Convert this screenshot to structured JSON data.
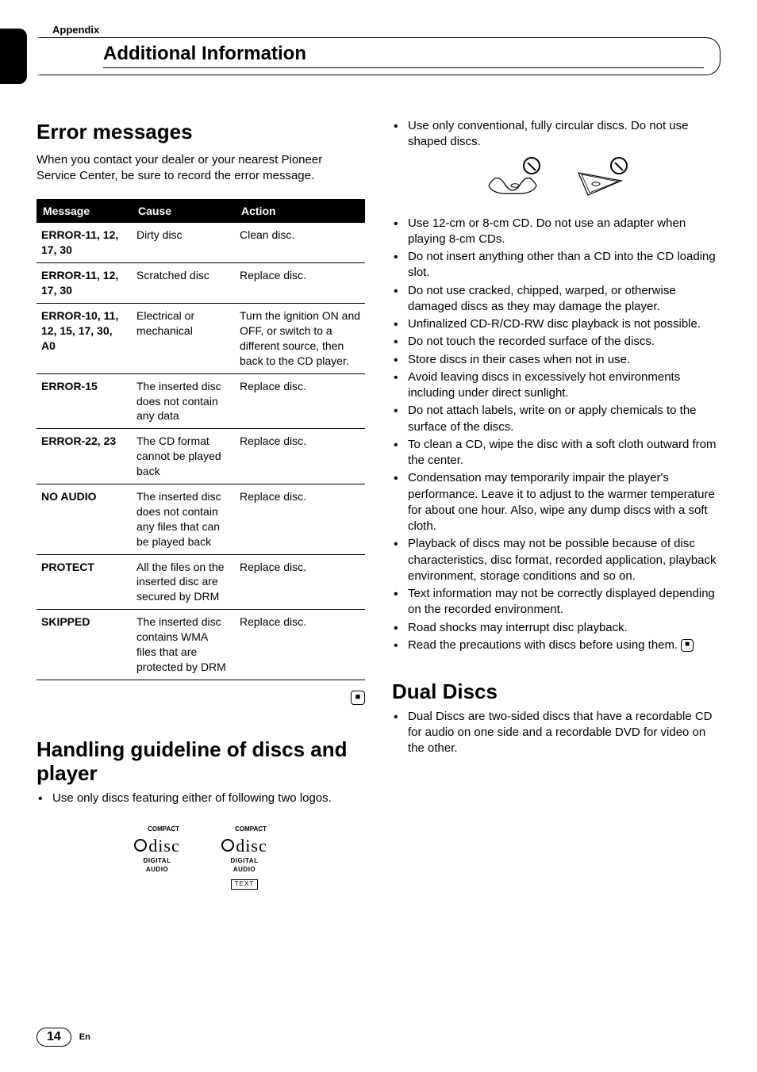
{
  "header": {
    "appendix": "Appendix",
    "title": "Additional Information"
  },
  "left": {
    "section1_title": "Error messages",
    "intro": "When you contact your dealer or your nearest Pioneer Service Center, be sure to record the error message.",
    "table": {
      "headers": {
        "c1": "Message",
        "c2": "Cause",
        "c3": "Action"
      },
      "rows": [
        {
          "c1": "ERROR-11, 12, 17, 30",
          "c2": "Dirty disc",
          "c3": "Clean disc."
        },
        {
          "c1": "ERROR-11, 12, 17, 30",
          "c2": "Scratched disc",
          "c3": "Replace disc."
        },
        {
          "c1": "ERROR-10, 11, 12, 15, 17, 30, A0",
          "c2": "Electrical or mechanical",
          "c3": "Turn the ignition ON and OFF, or switch to a different source, then back to the CD player."
        },
        {
          "c1": "ERROR-15",
          "c2": "The inserted disc does not contain any data",
          "c3": "Replace disc."
        },
        {
          "c1": "ERROR-22, 23",
          "c2": "The CD format cannot be played back",
          "c3": "Replace disc."
        },
        {
          "c1": "NO AUDIO",
          "c2": "The inserted disc does not contain any files that can be played back",
          "c3": "Replace disc."
        },
        {
          "c1": "PROTECT",
          "c2": "All the files on the inserted disc are secured by DRM",
          "c3": "Replace disc."
        },
        {
          "c1": "SKIPPED",
          "c2": "The inserted disc contains WMA files that are protected by DRM",
          "c3": "Replace disc."
        }
      ]
    },
    "section2_title": "Handling guideline of discs and player",
    "bullet1": "Use only discs featuring either of following two logos.",
    "logo": {
      "compact": "COMPACT",
      "digital_audio": "DIGITAL AUDIO",
      "text": "TEXT"
    }
  },
  "right": {
    "top_bullet": "Use only conventional, fully circular discs. Do not use shaped discs.",
    "bullets": [
      "Use 12-cm or 8-cm CD. Do not use an adapter when playing 8-cm CDs.",
      "Do not insert anything other than a CD into the CD loading slot.",
      "Do not use cracked, chipped, warped, or otherwise damaged discs as they may damage the player.",
      "Unfinalized CD-R/CD-RW disc playback is not possible.",
      "Do not touch the recorded surface of the discs.",
      "Store discs in their cases when not in use.",
      "Avoid leaving discs in excessively hot environments including under direct sunlight.",
      "Do not attach labels, write on or apply chemicals to the surface of the discs.",
      "To clean a CD, wipe the disc with a soft cloth outward from the center.",
      "Condensation may temporarily impair the player's performance. Leave it to adjust to the warmer temperature for about one hour. Also, wipe any dump discs with a soft cloth.",
      "Playback of discs may not be possible because of disc characteristics, disc format, recorded application, playback environment, storage conditions and so on.",
      "Text information may not be correctly displayed depending on the recorded environment.",
      "Road shocks may interrupt disc playback."
    ],
    "last_bullet": "Read the precautions with discs before using them.",
    "section3_title": "Dual Discs",
    "dual_bullet": "Dual Discs are two-sided discs that have a recordable CD for audio on one side and a recordable DVD for video on the other."
  },
  "footer": {
    "page": "14",
    "lang": "En"
  }
}
